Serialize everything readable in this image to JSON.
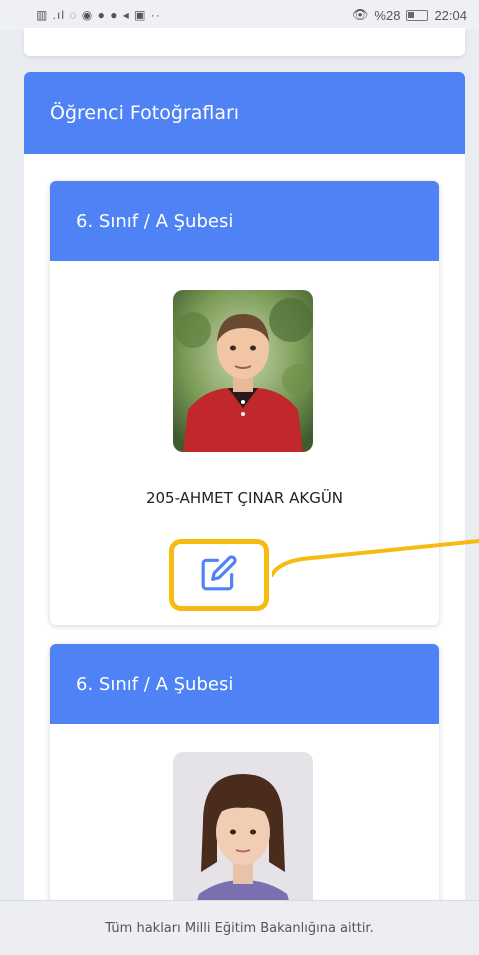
{
  "status_bar": {
    "left_icons": "▥ .ıl ◌ ◉ ● ● ◂ ▣ ··",
    "battery_text": "%28",
    "time": "22:04"
  },
  "section": {
    "title": "Öğrenci Fotoğrafları"
  },
  "students": [
    {
      "class_label": "6. Sınıf / A Şubesi",
      "name": "205-AHMET ÇINAR AKGÜN",
      "edit_icon": "edit-icon"
    },
    {
      "class_label": "6. Sınıf / A Şubesi",
      "name": ""
    }
  ],
  "footer": {
    "text": "Tüm hakları Milli Eğitim Bakanlığına aittir."
  },
  "colors": {
    "header_blue": "#4f82f5",
    "highlight_yellow": "#f5bb10",
    "icon_blue": "#4f82f5"
  }
}
